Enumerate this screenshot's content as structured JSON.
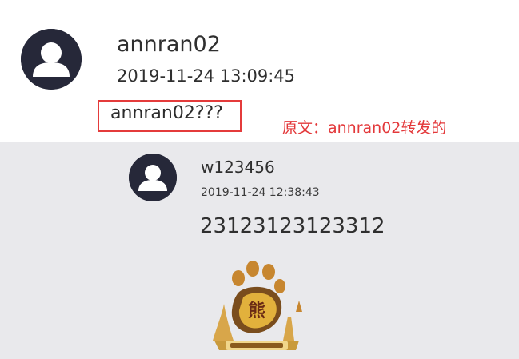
{
  "post": {
    "username": "annran02",
    "timestamp": "2019-11-24 13:09:45",
    "content": "annran02???"
  },
  "annotation": "原文：annran02转发的",
  "repost": {
    "username": "w123456",
    "timestamp": "2019-11-24 12:38:43",
    "content": "23123123123312",
    "image_icon": "game-logo-image"
  },
  "colors": {
    "avatar_bg": "#262839",
    "repost_bg": "#e9e9ec",
    "highlight": "#e43b3b"
  }
}
